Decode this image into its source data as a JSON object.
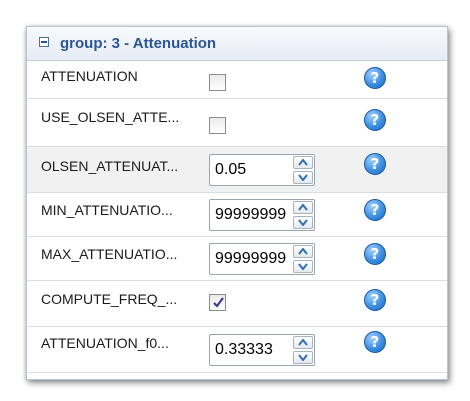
{
  "group": {
    "title": "group: 3 - Attenuation"
  },
  "help_icon_glyph": "?",
  "rows": [
    {
      "label": "ATTENUATION",
      "control": "checkbox",
      "checked": false
    },
    {
      "label": "USE_OLSEN_ATTE...",
      "control": "checkbox",
      "checked": false
    },
    {
      "label": "OLSEN_ATTENUAT...",
      "control": "spinner",
      "value": "0.05"
    },
    {
      "label": "MIN_ATTENUATIO...",
      "control": "spinner",
      "value": "99999999"
    },
    {
      "label": "MAX_ATTENUATIO...",
      "control": "spinner",
      "value": "99999999"
    },
    {
      "label": "COMPUTE_FREQ_...",
      "control": "checkbox",
      "checked": true
    },
    {
      "label": "ATTENUATION_f0...",
      "control": "spinner",
      "value": "0.33333"
    }
  ],
  "icons": [
    "collapse-toggle-icon",
    "help-icon",
    "spin-up-icon",
    "spin-down-icon",
    "checkmark-icon"
  ],
  "colors": {
    "header_title": "#2b5596",
    "help_icon": "#3d8fe0",
    "shaded_row": "#f1f1f1"
  }
}
